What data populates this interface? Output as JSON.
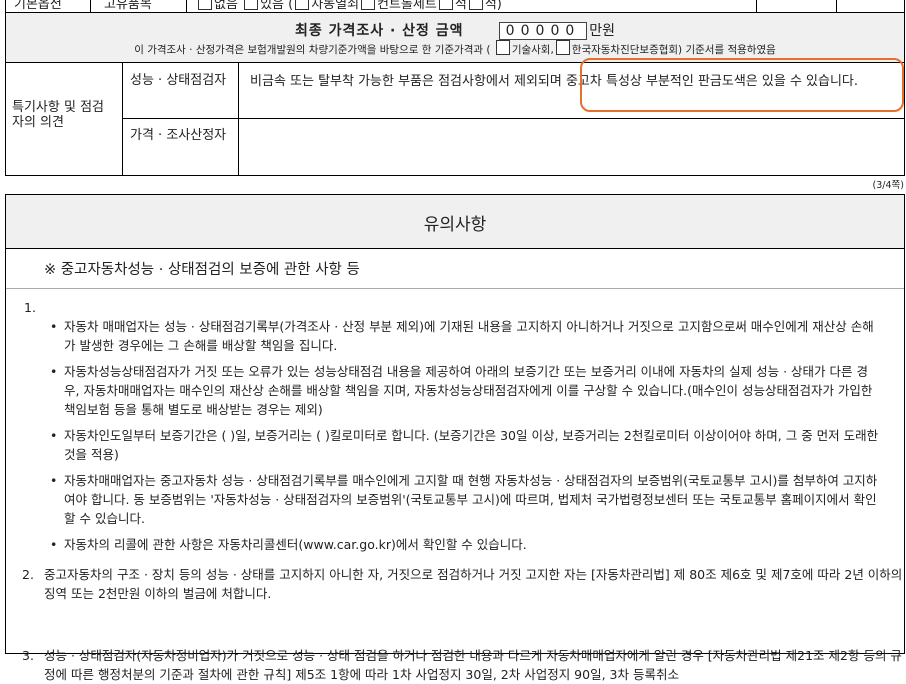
{
  "top_row": {
    "label": "기본옵션",
    "col2": "고유품목",
    "opt_none": "없음",
    "opt_some": "있음",
    "paren_open": "(",
    "opt_a": "자동열쇠",
    "opt_b": "컨트롤세트",
    "opt_c": "적",
    "opt_d": "적",
    "paren_close": ")"
  },
  "price": {
    "title": "최종 가격조사 · 산정 금액",
    "digits": [
      "0",
      "0",
      "0",
      "0",
      "0"
    ],
    "unit": "만원",
    "note_pre": "이 가격조사 · 산정가격은 보험개발원의 차량기준가액을 바탕으로 한 기준가격과 (",
    "note_opt1": "기술사회,",
    "note_opt2": "한국자동차진단보증협회) 기준서를 적용하였음"
  },
  "remarks": {
    "section_label": "특기사항 및 점검자의 의견",
    "row1_label": "성능 · 상태점검자",
    "row1_text": "비금속 또는 탈부착 가능한 부품은 점검사항에서 제외되며 중고차 특성상 부분적인 판금도색은 있을 수 있습니다.",
    "row2_label": "가격 · 조사산정자",
    "row2_text": ""
  },
  "page_no": "(3/4쪽)",
  "notice": {
    "title": "유의사항",
    "subtitle": "※ 중고자동차성능 · 상태점검의 보증에 관한 사항 등",
    "item1_num": "1.",
    "bullets": [
      "자동차 매매업자는 성능 · 상태점검기록부(가격조사 · 산정 부분 제외)에 기재된 내용을 고지하지 아니하거나 거짓으로 고지함으로써 매수인에게 재산상 손해가 발생한 경우에는 그 손해를 배상할 책임을 집니다.",
      "자동차성능상태점검자가 거짓 또는 오류가 있는 성능상태점검 내용을 제공하여 아래의 보증기간 또는 보증거리 이내에 자동차의 실제 성능 · 상태가 다른 경우, 자동차매매업자는 매수인의 재산상 손해를 배상할 책임을 지며, 자동차성능상태점검자에게 이를 구상할 수 있습니다.(매수인이 성능상태점검자가 가입한 책임보험 등을 통해 별도로 배상받는 경우는 제외)",
      "자동차인도일부터 보증기간은 (       )일, 보증거리는 (       )킬로미터로 합니다. (보증기간은 30일 이상, 보증거리는 2천킬로미터 이상이어야 하며, 그 중 먼저 도래한 것을 적용)",
      "자동차매매업자는 중고자동차 성능 · 상태점검기록부를 매수인에게 고지할 때 현행 자동차성능 · 상태점검자의 보증범위(국토교통부 고시)를 첨부하여 고지하여야 합니다. 동 보증범위는 '자동차성능 · 상태점검자의 보증범위'(국토교통부 고시)에 따르며, 법제처 국가법령정보센터 또는 국토교통부 홈페이지에서 확인할 수 있습니다.",
      "자동차의 리콜에 관한 사항은 자동차리콜센터(www.car.go.kr)에서 확인할 수 있습니다."
    ],
    "item2_num": "2.",
    "item2": "중고자동차의 구조 · 장치 등의 성능 · 상태를 고지하지 아니한 자, 거짓으로 점검하거나 거짓 고지한 자는 [자동차관리법] 제 80조 제6호 및 제7호에 따라 2년 이하의 징역 또는 2천만원 이하의 벌금에 처합니다.",
    "item3_num": "3.",
    "item3": "성능 · 상태점검자(자동차정비업자)가 거짓으로 성능 · 상태 점검을 하거나 점검한 내용과 다르게 자동차매매업자에게 알린 경우 [자동차관리법 제21조 제2항 등의 규정에 따른 행정처분의 기준과 절차에 관한 규칙] 제5조 1항에 따라 1차 사업정지 30일, 2차 사업정지 90일, 3차 등록취소"
  },
  "colors": {
    "highlight": "#e8702a",
    "header_bg": "#f0f0f0"
  }
}
